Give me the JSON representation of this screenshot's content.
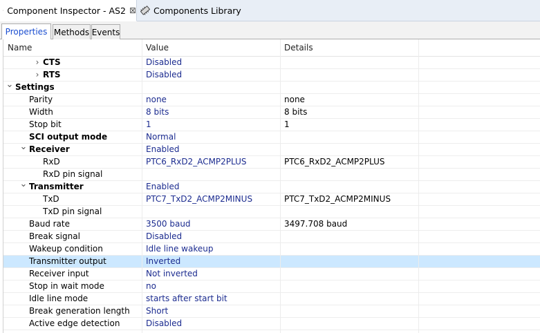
{
  "tabs": {
    "inspector": "Component Inspector - AS2",
    "inspector_close": "⊠",
    "library": "Components Library"
  },
  "subtabs": [
    "Properties",
    "Methods",
    "Events"
  ],
  "columns": {
    "name": "Name",
    "value": "Value",
    "details": "Details"
  },
  "rows": [
    {
      "name": "CTS",
      "value": "Disabled",
      "details": "",
      "level": 2,
      "bold": true,
      "expander": "collapsed"
    },
    {
      "name": "RTS",
      "value": "Disabled",
      "details": "",
      "level": 2,
      "bold": true,
      "expander": "collapsed"
    },
    {
      "name": "Settings",
      "value": "",
      "details": "",
      "level": 0,
      "bold": true,
      "expander": "expanded"
    },
    {
      "name": "Parity",
      "value": "none",
      "details": "none",
      "level": 1,
      "bold": false,
      "expander": "none"
    },
    {
      "name": "Width",
      "value": "8 bits",
      "details": "8 bits",
      "level": 1,
      "bold": false,
      "expander": "none"
    },
    {
      "name": "Stop bit",
      "value": "1",
      "details": "1",
      "level": 1,
      "bold": false,
      "expander": "none"
    },
    {
      "name": "SCI output mode",
      "value": "Normal",
      "details": "",
      "level": 1,
      "bold": true,
      "expander": "none"
    },
    {
      "name": "Receiver",
      "value": "Enabled",
      "details": "",
      "level": 1,
      "bold": true,
      "expander": "expanded"
    },
    {
      "name": "RxD",
      "value": "PTC6_RxD2_ACMP2PLUS",
      "details": "PTC6_RxD2_ACMP2PLUS",
      "level": 2,
      "bold": false,
      "expander": "none"
    },
    {
      "name": "RxD pin signal",
      "value": "",
      "details": "",
      "level": 2,
      "bold": false,
      "expander": "none"
    },
    {
      "name": "Transmitter",
      "value": "Enabled",
      "details": "",
      "level": 1,
      "bold": true,
      "expander": "expanded"
    },
    {
      "name": "TxD",
      "value": "PTC7_TxD2_ACMP2MINUS",
      "details": "PTC7_TxD2_ACMP2MINUS",
      "level": 2,
      "bold": false,
      "expander": "none"
    },
    {
      "name": "TxD pin signal",
      "value": "",
      "details": "",
      "level": 2,
      "bold": false,
      "expander": "none"
    },
    {
      "name": "Baud rate",
      "value": "3500 baud",
      "details": "3497.708 baud",
      "level": 1,
      "bold": false,
      "expander": "none"
    },
    {
      "name": "Break signal",
      "value": "Disabled",
      "details": "",
      "level": 1,
      "bold": false,
      "expander": "none"
    },
    {
      "name": "Wakeup condition",
      "value": "Idle line wakeup",
      "details": "",
      "level": 1,
      "bold": false,
      "expander": "none"
    },
    {
      "name": "Transmitter output",
      "value": "Inverted",
      "details": "",
      "level": 1,
      "bold": false,
      "expander": "none",
      "selected": true
    },
    {
      "name": "Receiver input",
      "value": "Not inverted",
      "details": "",
      "level": 1,
      "bold": false,
      "expander": "none"
    },
    {
      "name": "Stop in wait mode",
      "value": "no",
      "details": "",
      "level": 1,
      "bold": false,
      "expander": "none"
    },
    {
      "name": "Idle line mode",
      "value": "starts after start bit",
      "details": "",
      "level": 1,
      "bold": false,
      "expander": "none"
    },
    {
      "name": "Break generation length",
      "value": "Short",
      "details": "",
      "level": 1,
      "bold": false,
      "expander": "none"
    },
    {
      "name": "Active edge detection",
      "value": "Disabled",
      "details": "",
      "level": 1,
      "bold": false,
      "expander": "none"
    }
  ],
  "colors": {
    "selection": "#cce8ff",
    "value_text": "#1b2b8f",
    "active_subtab": "#1a4dd0"
  }
}
